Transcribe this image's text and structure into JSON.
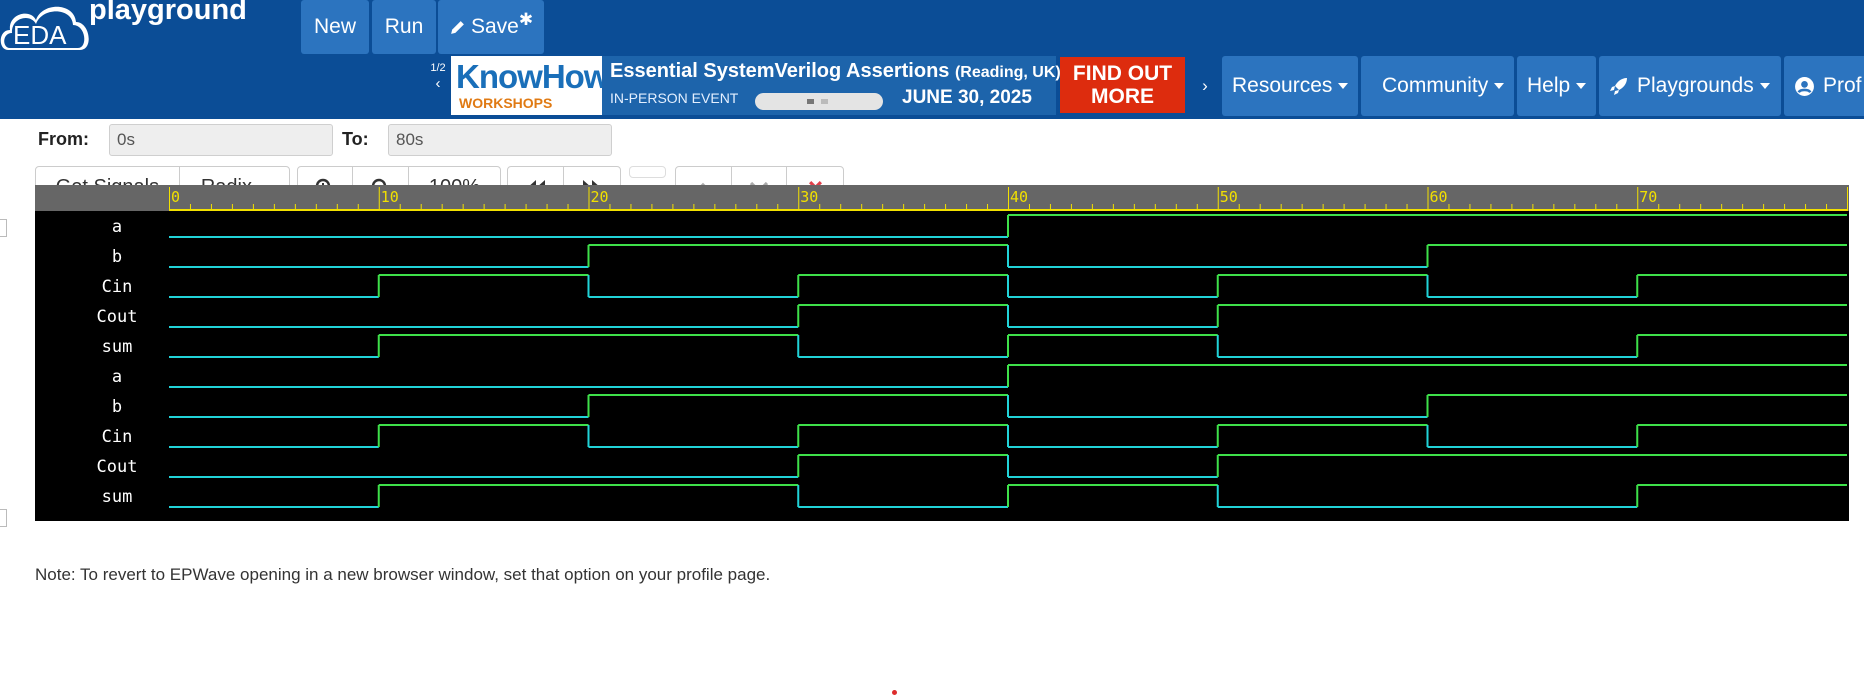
{
  "brand": {
    "logo_text": "EDA",
    "wordmark": "playground"
  },
  "toolbar": {
    "new_label": "New",
    "run_label": "Run",
    "save_label": "Save",
    "save_marker": "✱"
  },
  "carousel": {
    "counter": "1/2",
    "prev_icon": "chevron-left-icon",
    "next_icon": "chevron-right-icon"
  },
  "banner": {
    "logo": "KnowHow",
    "logo_sub": "WORKSHOPS",
    "title": "Essential SystemVerilog Assertions",
    "title_location": "(Reading, UK)",
    "event_type": "IN-PERSON EVENT",
    "date": "JUNE 30, 2025",
    "cta": "FIND OUT MORE",
    "colors": {
      "bg": "#1d64ab",
      "cta": "#dd2c0e",
      "accent": "#e07a13"
    }
  },
  "nav": {
    "resources": "Resources",
    "community": "Community",
    "help": "Help",
    "playgrounds": "Playgrounds",
    "profile": "Prof"
  },
  "range": {
    "from_label": "From:",
    "from_value": "0s",
    "to_label": "To:",
    "to_value": "80s"
  },
  "wave_toolbar": {
    "get_signals": "Get Signals",
    "radix": "Radix",
    "zoom_in_icon": "zoom-in-icon",
    "zoom_out_icon": "zoom-out-icon",
    "zoom_level": "100%",
    "prev_edge_icon": "fast-backward-icon",
    "next_edge_icon": "fast-forward-icon",
    "move_up_icon": "chevron-up-icon",
    "move_down_icon": "chevron-down-icon",
    "remove_icon": "close-icon"
  },
  "waveform": {
    "time_start": 0,
    "time_end": 80,
    "tick_labels": [
      "0",
      "10",
      "20",
      "30",
      "40",
      "50",
      "60",
      "70"
    ],
    "colors": {
      "background": "#000000",
      "ruler": "#666666",
      "tick": "#f2e000",
      "high": "#3ee04a",
      "low": "#21d3d8",
      "signal_name": "#ffffff"
    },
    "signals": [
      {
        "name": "a",
        "transitions": [
          [
            0,
            0
          ],
          [
            40,
            1
          ]
        ]
      },
      {
        "name": "b",
        "transitions": [
          [
            0,
            0
          ],
          [
            20,
            1
          ],
          [
            40,
            0
          ],
          [
            60,
            1
          ]
        ]
      },
      {
        "name": "Cin",
        "transitions": [
          [
            0,
            0
          ],
          [
            10,
            1
          ],
          [
            20,
            0
          ],
          [
            30,
            1
          ],
          [
            40,
            0
          ],
          [
            50,
            1
          ],
          [
            60,
            0
          ],
          [
            70,
            1
          ]
        ]
      },
      {
        "name": "Cout",
        "transitions": [
          [
            0,
            0
          ],
          [
            30,
            1
          ],
          [
            40,
            0
          ],
          [
            50,
            1
          ]
        ]
      },
      {
        "name": "sum",
        "transitions": [
          [
            0,
            0
          ],
          [
            10,
            1
          ],
          [
            30,
            0
          ],
          [
            40,
            1
          ],
          [
            50,
            0
          ],
          [
            70,
            1
          ]
        ]
      },
      {
        "name": "a",
        "transitions": [
          [
            0,
            0
          ],
          [
            40,
            1
          ]
        ]
      },
      {
        "name": "b",
        "transitions": [
          [
            0,
            0
          ],
          [
            20,
            1
          ],
          [
            40,
            0
          ],
          [
            60,
            1
          ]
        ]
      },
      {
        "name": "Cin",
        "transitions": [
          [
            0,
            0
          ],
          [
            10,
            1
          ],
          [
            20,
            0
          ],
          [
            30,
            1
          ],
          [
            40,
            0
          ],
          [
            50,
            1
          ],
          [
            60,
            0
          ],
          [
            70,
            1
          ]
        ]
      },
      {
        "name": "Cout",
        "transitions": [
          [
            0,
            0
          ],
          [
            30,
            1
          ],
          [
            40,
            0
          ],
          [
            50,
            1
          ]
        ]
      },
      {
        "name": "sum",
        "transitions": [
          [
            0,
            0
          ],
          [
            10,
            1
          ],
          [
            30,
            0
          ],
          [
            40,
            1
          ],
          [
            50,
            0
          ],
          [
            70,
            1
          ]
        ]
      }
    ]
  },
  "note": "Note: To revert to EPWave opening in a new browser window, set that option on your profile page."
}
